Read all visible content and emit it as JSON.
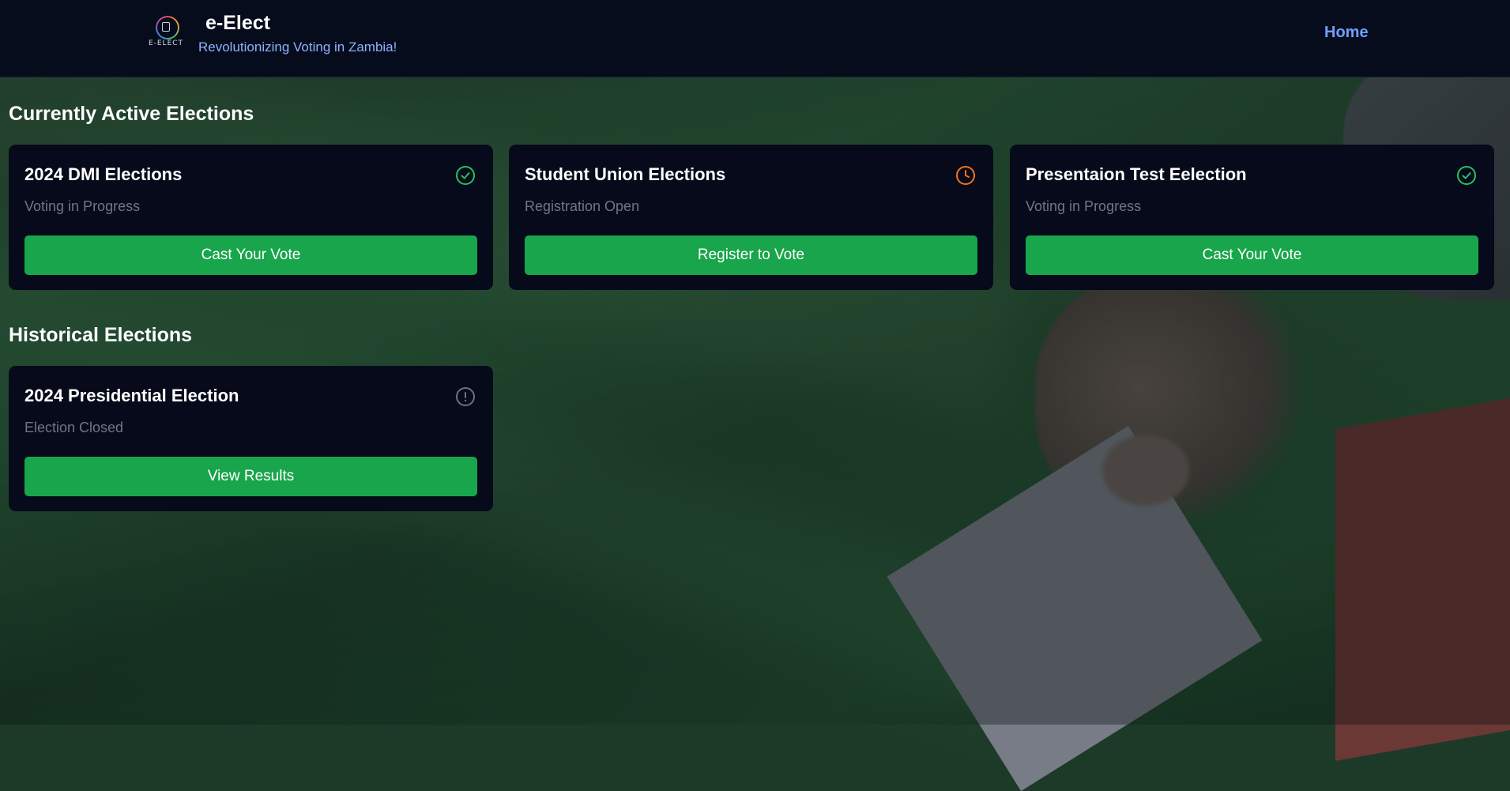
{
  "app": {
    "logo_text": "E-ELECT",
    "title": "e-Elect",
    "subtitle": "Revolutionizing Voting in Zambia!"
  },
  "nav": {
    "home_label": "Home"
  },
  "colors": {
    "header_bg": "#070c1c",
    "card_bg": "#060a1a",
    "button_green": "#19a54b",
    "nav_link": "#6ea0ff",
    "icon_success": "#22c55e",
    "icon_pending": "#f97316",
    "icon_closed": "#6b7280"
  },
  "active_section": {
    "title": "Currently Active Elections",
    "cards": [
      {
        "title": "2024 DMI Elections",
        "status": "Voting in Progress",
        "icon": "check-circle-icon",
        "button_label": "Cast Your Vote"
      },
      {
        "title": "Student Union Elections",
        "status": "Registration Open",
        "icon": "clock-icon",
        "button_label": "Register to Vote"
      },
      {
        "title": "Presentaion Test Eelection",
        "status": "Voting in Progress",
        "icon": "check-circle-icon",
        "button_label": "Cast Your Vote"
      }
    ]
  },
  "historical_section": {
    "title": "Historical Elections",
    "cards": [
      {
        "title": "2024 Presidential Election",
        "status": "Election Closed",
        "icon": "alert-circle-icon",
        "button_label": "View Results"
      }
    ]
  }
}
